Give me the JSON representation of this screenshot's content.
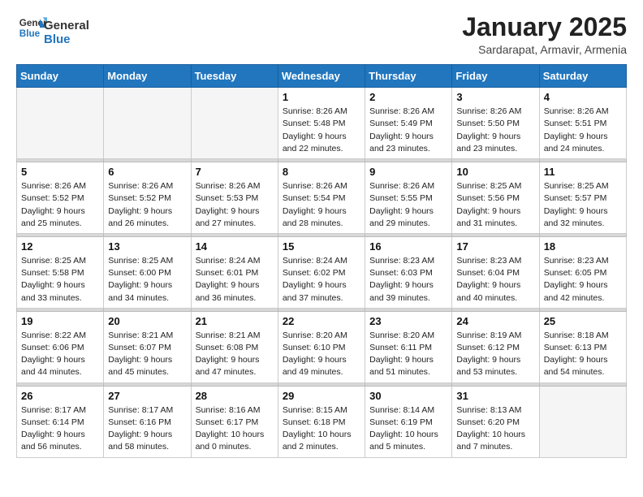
{
  "header": {
    "logo_general": "General",
    "logo_blue": "Blue",
    "month_title": "January 2025",
    "location": "Sardarapat, Armavir, Armenia"
  },
  "weekdays": [
    "Sunday",
    "Monday",
    "Tuesday",
    "Wednesday",
    "Thursday",
    "Friday",
    "Saturday"
  ],
  "weeks": [
    [
      {
        "day": null
      },
      {
        "day": null
      },
      {
        "day": null
      },
      {
        "day": 1,
        "sunrise": "8:26 AM",
        "sunset": "5:48 PM",
        "daylight": "9 hours and 22 minutes."
      },
      {
        "day": 2,
        "sunrise": "8:26 AM",
        "sunset": "5:49 PM",
        "daylight": "9 hours and 23 minutes."
      },
      {
        "day": 3,
        "sunrise": "8:26 AM",
        "sunset": "5:50 PM",
        "daylight": "9 hours and 23 minutes."
      },
      {
        "day": 4,
        "sunrise": "8:26 AM",
        "sunset": "5:51 PM",
        "daylight": "9 hours and 24 minutes."
      }
    ],
    [
      {
        "day": 5,
        "sunrise": "8:26 AM",
        "sunset": "5:52 PM",
        "daylight": "9 hours and 25 minutes."
      },
      {
        "day": 6,
        "sunrise": "8:26 AM",
        "sunset": "5:52 PM",
        "daylight": "9 hours and 26 minutes."
      },
      {
        "day": 7,
        "sunrise": "8:26 AM",
        "sunset": "5:53 PM",
        "daylight": "9 hours and 27 minutes."
      },
      {
        "day": 8,
        "sunrise": "8:26 AM",
        "sunset": "5:54 PM",
        "daylight": "9 hours and 28 minutes."
      },
      {
        "day": 9,
        "sunrise": "8:26 AM",
        "sunset": "5:55 PM",
        "daylight": "9 hours and 29 minutes."
      },
      {
        "day": 10,
        "sunrise": "8:25 AM",
        "sunset": "5:56 PM",
        "daylight": "9 hours and 31 minutes."
      },
      {
        "day": 11,
        "sunrise": "8:25 AM",
        "sunset": "5:57 PM",
        "daylight": "9 hours and 32 minutes."
      }
    ],
    [
      {
        "day": 12,
        "sunrise": "8:25 AM",
        "sunset": "5:58 PM",
        "daylight": "9 hours and 33 minutes."
      },
      {
        "day": 13,
        "sunrise": "8:25 AM",
        "sunset": "6:00 PM",
        "daylight": "9 hours and 34 minutes."
      },
      {
        "day": 14,
        "sunrise": "8:24 AM",
        "sunset": "6:01 PM",
        "daylight": "9 hours and 36 minutes."
      },
      {
        "day": 15,
        "sunrise": "8:24 AM",
        "sunset": "6:02 PM",
        "daylight": "9 hours and 37 minutes."
      },
      {
        "day": 16,
        "sunrise": "8:23 AM",
        "sunset": "6:03 PM",
        "daylight": "9 hours and 39 minutes."
      },
      {
        "day": 17,
        "sunrise": "8:23 AM",
        "sunset": "6:04 PM",
        "daylight": "9 hours and 40 minutes."
      },
      {
        "day": 18,
        "sunrise": "8:23 AM",
        "sunset": "6:05 PM",
        "daylight": "9 hours and 42 minutes."
      }
    ],
    [
      {
        "day": 19,
        "sunrise": "8:22 AM",
        "sunset": "6:06 PM",
        "daylight": "9 hours and 44 minutes."
      },
      {
        "day": 20,
        "sunrise": "8:21 AM",
        "sunset": "6:07 PM",
        "daylight": "9 hours and 45 minutes."
      },
      {
        "day": 21,
        "sunrise": "8:21 AM",
        "sunset": "6:08 PM",
        "daylight": "9 hours and 47 minutes."
      },
      {
        "day": 22,
        "sunrise": "8:20 AM",
        "sunset": "6:10 PM",
        "daylight": "9 hours and 49 minutes."
      },
      {
        "day": 23,
        "sunrise": "8:20 AM",
        "sunset": "6:11 PM",
        "daylight": "9 hours and 51 minutes."
      },
      {
        "day": 24,
        "sunrise": "8:19 AM",
        "sunset": "6:12 PM",
        "daylight": "9 hours and 53 minutes."
      },
      {
        "day": 25,
        "sunrise": "8:18 AM",
        "sunset": "6:13 PM",
        "daylight": "9 hours and 54 minutes."
      }
    ],
    [
      {
        "day": 26,
        "sunrise": "8:17 AM",
        "sunset": "6:14 PM",
        "daylight": "9 hours and 56 minutes."
      },
      {
        "day": 27,
        "sunrise": "8:17 AM",
        "sunset": "6:16 PM",
        "daylight": "9 hours and 58 minutes."
      },
      {
        "day": 28,
        "sunrise": "8:16 AM",
        "sunset": "6:17 PM",
        "daylight": "10 hours and 0 minutes."
      },
      {
        "day": 29,
        "sunrise": "8:15 AM",
        "sunset": "6:18 PM",
        "daylight": "10 hours and 2 minutes."
      },
      {
        "day": 30,
        "sunrise": "8:14 AM",
        "sunset": "6:19 PM",
        "daylight": "10 hours and 5 minutes."
      },
      {
        "day": 31,
        "sunrise": "8:13 AM",
        "sunset": "6:20 PM",
        "daylight": "10 hours and 7 minutes."
      },
      {
        "day": null
      }
    ]
  ]
}
